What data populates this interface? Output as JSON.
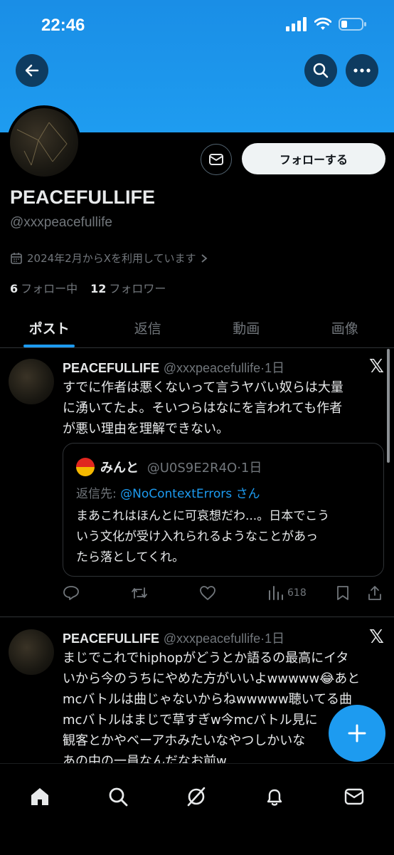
{
  "status_bar": {
    "time": "22:46"
  },
  "profile": {
    "display_name": "PEACEFULLIFE",
    "handle": "@xxxpeacefullife",
    "joined": "2024年2月からXを利用しています",
    "following_count": "6",
    "following_label": "フォロー中",
    "followers_count": "12",
    "followers_label": "フォロワー",
    "follow_label": "フォローする"
  },
  "tabs": [
    {
      "label": "ポスト",
      "active": true
    },
    {
      "label": "返信",
      "active": false
    },
    {
      "label": "動画",
      "active": false
    },
    {
      "label": "画像",
      "active": false
    }
  ],
  "posts": [
    {
      "name": "PEACEFULLIFE",
      "meta": "@xxxpeacefullife·1日",
      "text_lines": [
        "すでに作者は悪くないって言うヤバい奴らは大量",
        "に湧いてたよ。そいつらはなにを言われても作者",
        "が悪い理由を理解できない。"
      ],
      "quote": {
        "name": "みんと",
        "meta": "@U0S9E2R4O·1日",
        "reply_prefix": "返信先:",
        "reply_link": "@NoContextErrors",
        "reply_suffix": "さん",
        "text_lines": [
          "まあこれはほんとに可哀想だわ...。日本でこう",
          "いう文化が受け入れられるようなことがあっ",
          "たら落としてくれ。"
        ]
      },
      "views": "618"
    },
    {
      "name": "PEACEFULLIFE",
      "meta": "@xxxpeacefullife·1日",
      "text_lines": [
        "まじでこれでhiphopがどうとか語るの最高にイタ",
        "いから今のうちにやめた方がいいよwwwww😂あと",
        "mcバトルは曲じゃないからねwwwww聴いてる曲",
        "mcバトルはまじで草すぎw今mcバトル見に",
        "観客とかやベーアホみたいなやつしかいな",
        "あの中の一員なんだなお前w"
      ]
    }
  ]
}
